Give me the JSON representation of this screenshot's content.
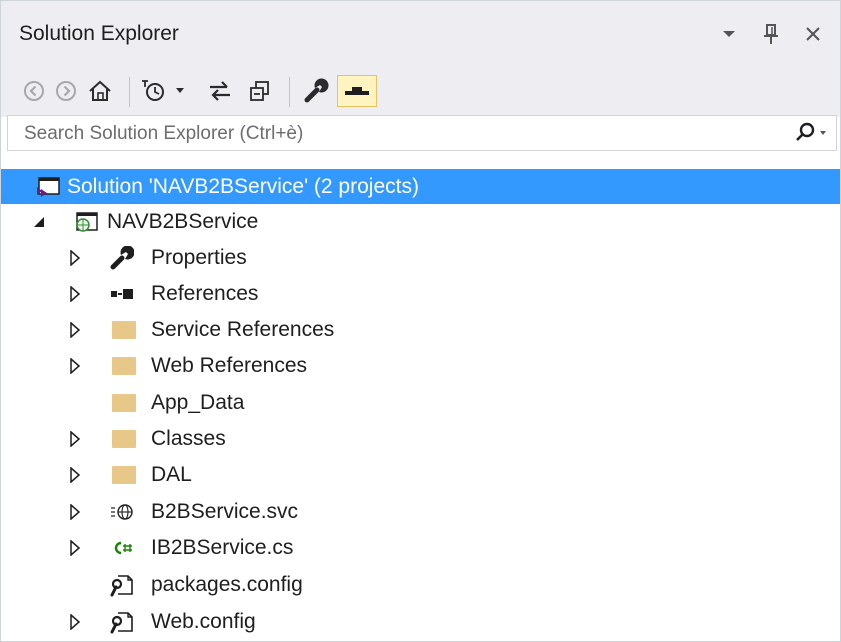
{
  "title": "Solution Explorer",
  "title_controls": [
    "dropdown-icon",
    "pin-icon",
    "close-icon"
  ],
  "toolbar": {
    "buttons": [
      "back-icon",
      "forward-icon",
      "home-icon",
      "pending-changes-icon",
      "sync-icon",
      "collapse-all-icon",
      "properties-icon",
      "preview-icon"
    ]
  },
  "search": {
    "placeholder": "Search Solution Explorer (Ctrl+è)",
    "value": ""
  },
  "colors": {
    "selection": "#3399ff",
    "folder": "#e8c888",
    "background": "#eeeef2",
    "csharp": "#178600"
  },
  "tree": [
    {
      "label": "Solution 'NAVB2BService' (2 projects)",
      "icon": "solution-icon",
      "level": 0,
      "expander": "none",
      "selected": true
    },
    {
      "label": "NAVB2BService",
      "icon": "web-project-icon",
      "level": 1,
      "expander": "expanded"
    },
    {
      "label": "Properties",
      "icon": "wrench-icon",
      "level": 2,
      "expander": "collapsed"
    },
    {
      "label": "References",
      "icon": "references-icon",
      "level": 2,
      "expander": "collapsed"
    },
    {
      "label": "Service References",
      "icon": "folder-icon",
      "level": 2,
      "expander": "collapsed"
    },
    {
      "label": "Web References",
      "icon": "folder-icon",
      "level": 2,
      "expander": "collapsed"
    },
    {
      "label": "App_Data",
      "icon": "folder-icon",
      "level": 2,
      "expander": "none"
    },
    {
      "label": "Classes",
      "icon": "folder-icon",
      "level": 2,
      "expander": "collapsed"
    },
    {
      "label": "DAL",
      "icon": "folder-icon",
      "level": 2,
      "expander": "collapsed"
    },
    {
      "label": "B2BService.svc",
      "icon": "service-file-icon",
      "level": 2,
      "expander": "collapsed"
    },
    {
      "label": "IB2BService.cs",
      "icon": "csharp-file-icon",
      "level": 2,
      "expander": "collapsed"
    },
    {
      "label": "packages.config",
      "icon": "config-file-icon",
      "level": 2,
      "expander": "none"
    },
    {
      "label": "Web.config",
      "icon": "config-file-icon",
      "level": 2,
      "expander": "collapsed"
    }
  ]
}
